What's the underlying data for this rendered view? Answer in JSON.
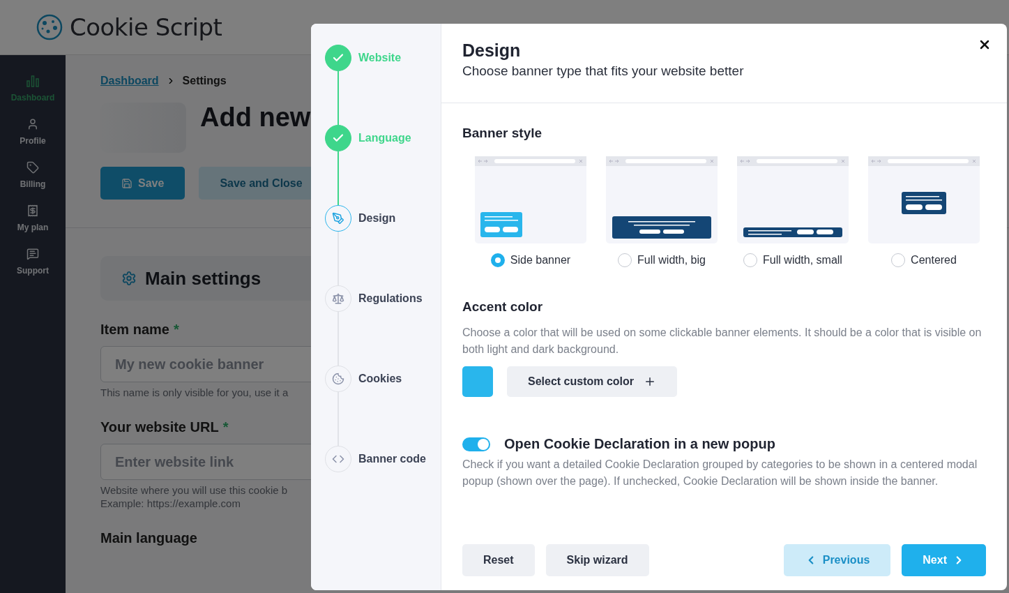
{
  "header": {
    "logo": "Cookie Script"
  },
  "sidebar": {
    "items": [
      {
        "label": "Dashboard",
        "selected": true,
        "kind": "chart"
      },
      {
        "label": "Profile",
        "selected": false,
        "kind": "user"
      },
      {
        "label": "Billing",
        "selected": false,
        "kind": "tag"
      },
      {
        "label": "My plan",
        "selected": false,
        "kind": "plan"
      },
      {
        "label": "Support",
        "selected": false,
        "kind": "support"
      }
    ]
  },
  "breadcrumb": [
    "Dashboard",
    "Settings"
  ],
  "page_title": "Add new",
  "page_buttons": [
    {
      "label": "Save",
      "kind": "primary"
    },
    {
      "label": "Save and Close",
      "kind": "secondary"
    }
  ],
  "section_title": "Main settings",
  "form_fields": [
    {
      "label": "Item name",
      "required_mark": "*",
      "placeholder": "My new cookie banner",
      "hints": [
        "This name is only visible for you, use it a"
      ]
    },
    {
      "label": "Your website URL",
      "required_mark": "*",
      "placeholder": "Enter website link",
      "hints": [
        "Website where you will use this cookie b",
        "Example: https://example.com"
      ]
    },
    {
      "label": "Main language"
    }
  ],
  "wizard": {
    "steps": [
      {
        "label": "Website",
        "completed": true,
        "selected": false
      },
      {
        "label": "Language",
        "completed": true,
        "selected": false
      },
      {
        "label": "Design",
        "completed": false,
        "selected": true,
        "kind": "design"
      },
      {
        "label": "Regulations",
        "completed": false,
        "selected": false,
        "kind": "regulations"
      },
      {
        "label": "Cookies",
        "completed": false,
        "selected": false,
        "kind": "cookies"
      },
      {
        "label": "Banner code",
        "completed": false,
        "selected": false,
        "kind": "code"
      }
    ],
    "title": "Design",
    "subtitle": "Choose banner type that fits your website better",
    "banner_style": {
      "heading": "Banner style",
      "options": [
        {
          "label": "Side banner",
          "selected": true,
          "kind": "side"
        },
        {
          "label": "Full width, big",
          "selected": false,
          "kind": "full_big"
        },
        {
          "label": "Full width, small",
          "selected": false,
          "kind": "full_small"
        },
        {
          "label": "Centered",
          "selected": false,
          "kind": "centered"
        }
      ]
    },
    "accent": {
      "heading": "Accent color",
      "description": "Choose a color that will be used on some clickable banner elements. It should be a color that is visible on both light and dark background.",
      "color": "#29b6ec",
      "button": "Select custom color"
    },
    "popup_toggle": {
      "label": "Open Cookie Declaration in a new popup",
      "on": true,
      "description": "Check if you want a detailed Cookie Declaration grouped by categories to be shown in a centered modal popup (shown over the page). If unchecked, Cookie Declaration will be shown inside the banner."
    },
    "footer": [
      {
        "label": "Reset",
        "kind": "plain"
      },
      {
        "label": "Skip wizard",
        "kind": "plain"
      },
      {
        "label": "Previous",
        "kind": "previous"
      },
      {
        "label": "Next",
        "kind": "next"
      }
    ]
  }
}
